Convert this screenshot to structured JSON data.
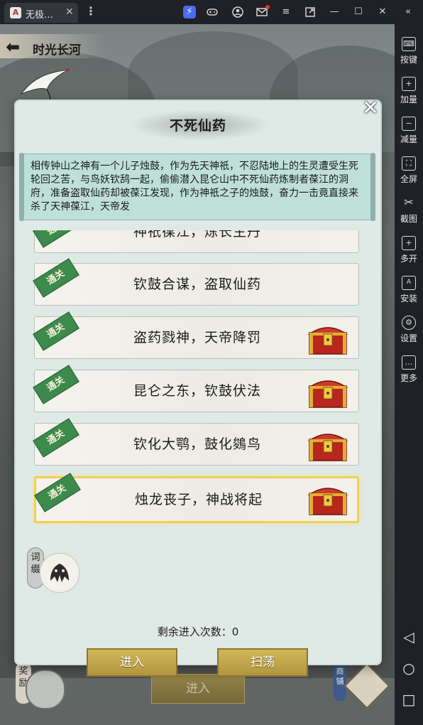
{
  "window": {
    "tab_title": "无极…",
    "tab_logo_text": "A",
    "tab_close": "✕",
    "menu_icon": "⋮",
    "toolbar_icons": [
      "bolt-icon",
      "gamepad-icon",
      "user-icon",
      "mail-icon",
      "menu-icon",
      "popout-icon",
      "minimize-icon",
      "maximize-icon",
      "close-icon",
      "collapse-icon"
    ]
  },
  "sidebar": {
    "items": [
      {
        "label": "按键",
        "icon": "keyboard-icon",
        "glyph": "⌨"
      },
      {
        "label": "加量",
        "icon": "volume-up-icon",
        "glyph": "+"
      },
      {
        "label": "减量",
        "icon": "volume-down-icon",
        "glyph": "−"
      },
      {
        "label": "全屏",
        "icon": "fullscreen-icon",
        "glyph": "⛶"
      },
      {
        "label": "截图",
        "icon": "scissors-icon",
        "glyph": "✂"
      },
      {
        "label": "多开",
        "icon": "multi-instance-icon",
        "glyph": "+"
      },
      {
        "label": "安装",
        "icon": "apk-icon",
        "glyph": "A"
      },
      {
        "label": "设置",
        "icon": "settings-icon",
        "glyph": "⚙"
      },
      {
        "label": "更多",
        "icon": "more-icon",
        "glyph": "…"
      }
    ],
    "nav": [
      {
        "icon": "back-triangle-icon",
        "glyph": "◁"
      },
      {
        "icon": "home-circle-icon",
        "glyph": "○"
      },
      {
        "icon": "recents-square-icon",
        "glyph": "□"
      }
    ]
  },
  "game": {
    "back_title": "时光长河",
    "bg_reward_tag": "奖励",
    "bg_enter_label": "进入",
    "bg_shop_tag": "商铺"
  },
  "modal": {
    "title": "不死仙药",
    "story": "相传钟山之神有一个儿子烛鼓，作为先天神祇，不忍陆地上的生灵遭受生死轮回之苦，与鸟妖钦鸹一起，偷偷潜入昆仑山中不死仙药炼制者葆江的洞府，准备盗取仙药却被葆江发现，作为神祇之子的烛鼓，奋力一击竟直接来杀了天神葆江，天帝发",
    "stages": [
      {
        "name": "神祇葆江，炼长生丹",
        "cleared": true,
        "chest": false,
        "selected": false
      },
      {
        "name": "钦鼓合谋，盗取仙药",
        "cleared": true,
        "chest": false,
        "selected": false
      },
      {
        "name": "盗药戮神，天帝降罚",
        "cleared": true,
        "chest": true,
        "selected": false
      },
      {
        "name": "昆仑之东，钦鼓伏法",
        "cleared": true,
        "chest": true,
        "selected": false
      },
      {
        "name": "钦化大鹗，鼓化鵕鸟",
        "cleared": true,
        "chest": true,
        "selected": false
      },
      {
        "name": "烛龙丧子，神战将起",
        "cleared": true,
        "chest": true,
        "selected": true
      }
    ],
    "clear_label": "通关",
    "affix_tag": "词缀",
    "remaining_text": "剩余进入次数：0",
    "enter_label": "进入",
    "sweep_label": "扫荡",
    "close_glyph": "✕"
  },
  "colors": {
    "accent_gold": "#d2b65a",
    "clear_green": "#3c8a4c",
    "chest_red": "#b8261e",
    "selected_border": "#f0cf52"
  }
}
